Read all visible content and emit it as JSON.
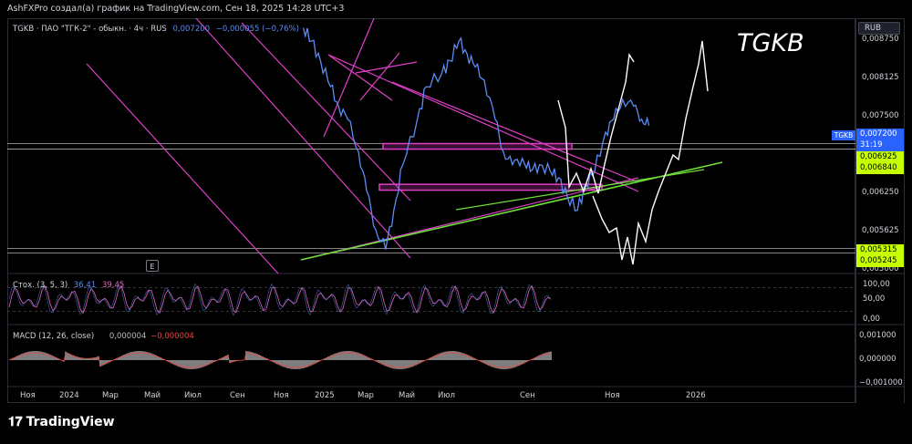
{
  "header": {
    "title": "AshFXPro создал(а) график на TradingView.com, Сен 18, 2025 14:28 UTC+3"
  },
  "legend": {
    "symbol_line": "TGKB · ПАО \"ТГК-2\" - обыкн. · 4ч · RUS",
    "price": "0,007200",
    "change": "−0,000055 (−0,76%)"
  },
  "annotation_text": "TGKB",
  "currency_button": "RUB",
  "ticker_tag": "TGKB",
  "price_axis": {
    "ticks": [
      "0,008750",
      "0,008125",
      "0,007500",
      "0,006250",
      "0,005625",
      "0,005000"
    ],
    "tags": [
      {
        "label": "0,007200",
        "color": "#2962ff",
        "text_color": "#ffffff"
      },
      {
        "label": "31:19",
        "color": "#2962ff",
        "text_color": "#ffffff"
      },
      {
        "label": "0,006925",
        "color": "#c6ff00",
        "text_color": "#000000"
      },
      {
        "label": "0,006840",
        "color": "#c6ff00",
        "text_color": "#000000"
      },
      {
        "label": "0,005315",
        "color": "#c6ff00",
        "text_color": "#000000"
      },
      {
        "label": "0,005245",
        "color": "#c6ff00",
        "text_color": "#000000"
      }
    ]
  },
  "stoch": {
    "label": "Стох. (3, 5, 3)",
    "k": "36,41",
    "d": "39,45",
    "ticks": [
      "100,00",
      "50,00",
      "0,00"
    ]
  },
  "macd": {
    "label": "MACD (12, 26, close)",
    "hist": "0,000004",
    "signal": "−0,000004",
    "ticks": [
      "0,001000",
      "0,000000",
      "−0,001000"
    ]
  },
  "time_axis": [
    "Ноя",
    "2024",
    "Мар",
    "Май",
    "Июл",
    "Сен",
    "Ноя",
    "2025",
    "Мар",
    "Май",
    "Июл",
    "Сен",
    "Ноя",
    "2026"
  ],
  "e_button": "E",
  "footer": {
    "brand": "TradingView"
  },
  "colors": {
    "price_line": "#5b8cf5",
    "trendline": "#e040c8",
    "support_line": "#6ee03a",
    "zone": "#e040c8",
    "projection": "#ffffff",
    "stoch_k": "#5b8cf5",
    "stoch_d": "#e066c0",
    "macd_bar": "#9e9e9e",
    "macd_signal": "#ef4444"
  },
  "chart_data": {
    "type": "line",
    "title": "TGKB · ПАО \"ТГК-2\" - обыкн. · 4ч · RUS",
    "xlabel": "",
    "ylabel": "",
    "x_range": [
      "2023-11",
      "2026-01"
    ],
    "ylim": [
      0.005,
      0.00875
    ],
    "series": [
      {
        "name": "TGKB",
        "x": [
          "2024-09-01",
          "2024-09-10",
          "2024-09-20",
          "2024-10-01",
          "2024-10-10",
          "2024-10-20",
          "2024-11-01",
          "2024-11-10",
          "2024-11-20",
          "2024-12-01",
          "2024-12-10",
          "2024-12-20",
          "2025-01-05",
          "2025-01-15",
          "2025-02-01",
          "2025-02-10",
          "2025-02-20",
          "2025-03-01",
          "2025-03-10",
          "2025-03-20",
          "2025-04-01",
          "2025-04-10",
          "2025-04-20",
          "2025-05-01",
          "2025-05-10",
          "2025-05-20",
          "2025-06-01",
          "2025-06-10",
          "2025-06-20",
          "2025-07-01",
          "2025-07-10",
          "2025-07-20",
          "2025-08-01",
          "2025-08-10",
          "2025-08-20",
          "2025-09-01",
          "2025-09-10",
          "2025-09-18"
        ],
        "values": [
          0.0087,
          0.0085,
          0.0082,
          0.0078,
          0.0075,
          0.0073,
          0.0068,
          0.0062,
          0.0056,
          0.0053,
          0.0059,
          0.0066,
          0.0073,
          0.0078,
          0.008,
          0.0082,
          0.0085,
          0.0083,
          0.0081,
          0.0079,
          0.0073,
          0.0068,
          0.0066,
          0.0067,
          0.0065,
          0.0066,
          0.0065,
          0.0064,
          0.0061,
          0.0059,
          0.0063,
          0.0065,
          0.0071,
          0.0073,
          0.0076,
          0.0075,
          0.0073,
          0.0072
        ]
      }
    ],
    "levels": [
      0.006925,
      0.00684,
      0.005315,
      0.005245
    ],
    "zones": [
      [
        0.00684,
        0.006925
      ],
      [
        0.00621,
        0.0063
      ]
    ],
    "stochastic": {
      "k": 36.41,
      "d": 39.45,
      "ylim": [
        0,
        100
      ]
    },
    "macd": {
      "hist": 4e-06,
      "signal": -4e-06,
      "ylim": [
        -0.001,
        0.001
      ]
    },
    "grid": false,
    "legend": "top-left"
  }
}
